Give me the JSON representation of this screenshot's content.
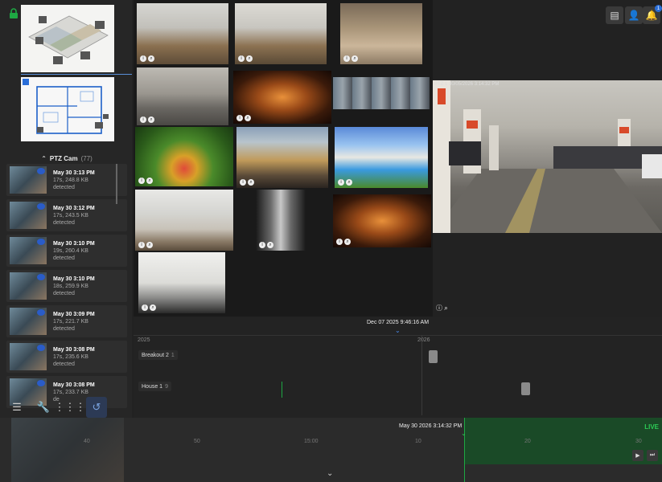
{
  "left_panel": {
    "ptz_header": {
      "name": "PTZ Cam",
      "count": "(77)"
    },
    "events": [
      {
        "time": "May 30 3:13 PM",
        "details": "17s, 248.8 KB",
        "status": "detected"
      },
      {
        "time": "May 30 3:12 PM",
        "details": "17s, 243.5 KB",
        "status": "detected"
      },
      {
        "time": "May 30 3:10 PM",
        "details": "19s, 260.4 KB",
        "status": "detected"
      },
      {
        "time": "May 30 3:10 PM",
        "details": "18s, 259.9 KB",
        "status": "detected"
      },
      {
        "time": "May 30 3:09 PM",
        "details": "17s, 221.7 KB",
        "status": "detected"
      },
      {
        "time": "May 30 3:08 PM",
        "details": "17s, 235.6 KB",
        "status": "detected"
      },
      {
        "time": "May 30 3:08 PM",
        "details": "17s, 233.7 KB",
        "status": "de"
      }
    ]
  },
  "big_view": {
    "timestamp": "PTZ 1 30/05/2026 3:14:32 PM"
  },
  "top_right": {
    "notification_count": "1"
  },
  "timeline": {
    "cursor_date": "Dec 07 2025 9:46:16 AM",
    "year_left": "2025",
    "year_right": "2026",
    "rows": [
      {
        "name": "Breakout 2",
        "count": "1"
      },
      {
        "name": "House 1",
        "count": "9"
      }
    ]
  },
  "playback": {
    "current_time": "May 30 2026 3:14:32 PM",
    "live_label": "LIVE",
    "ticks": [
      "40",
      "50",
      "15:00",
      "10",
      "20",
      "30"
    ]
  },
  "colors": {
    "accent": "#2a6ed8",
    "live": "#2ccb55",
    "lock": "#1ea843"
  }
}
